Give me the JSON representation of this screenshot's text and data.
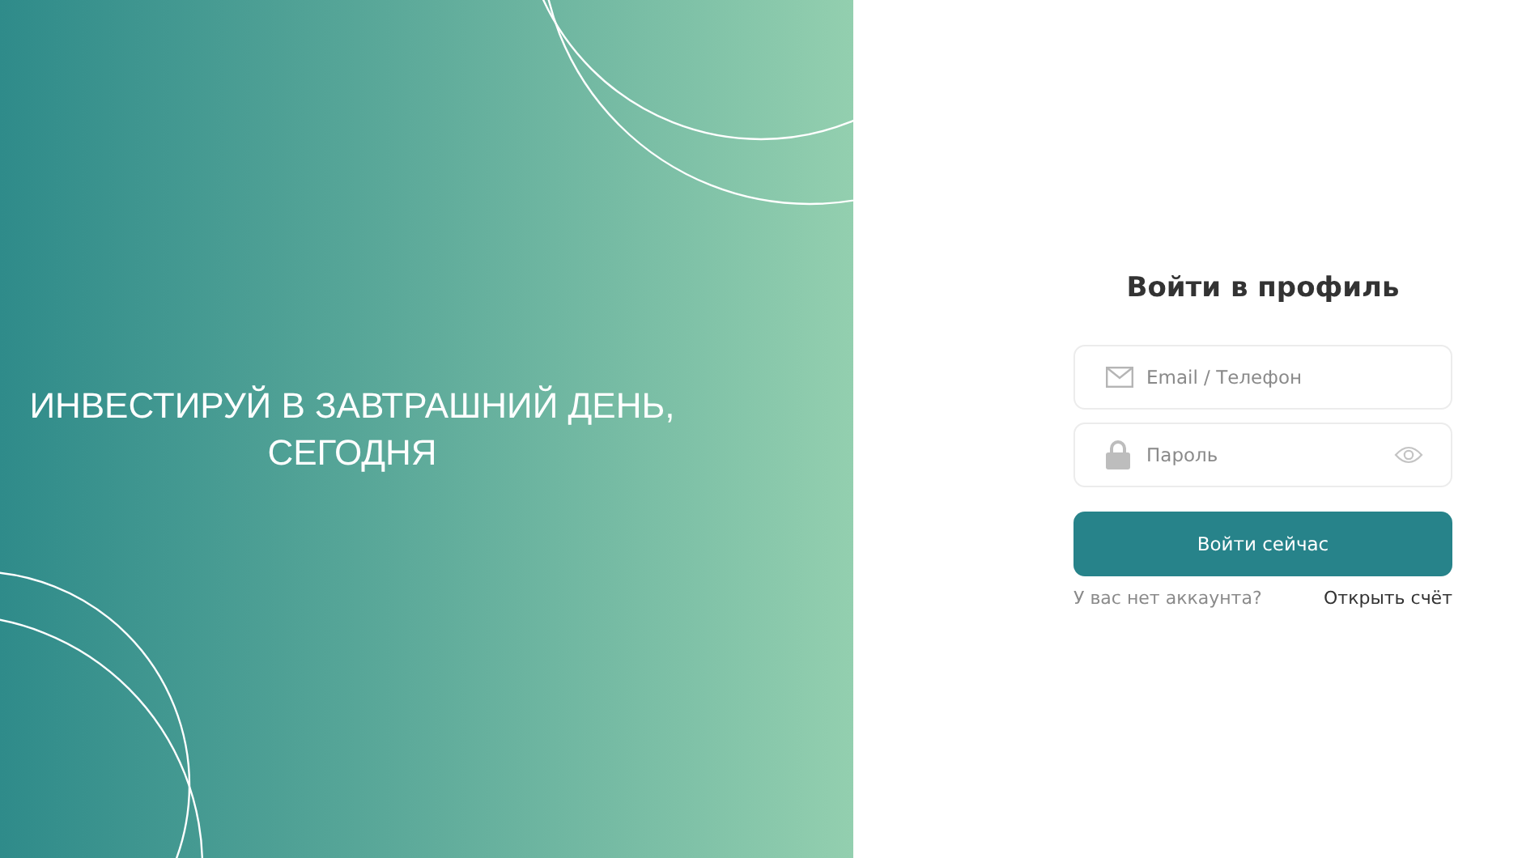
{
  "hero": {
    "headline_lines": [
      "ИНВЕСТИРУЙ В ЗАВТРАШНИЙ ДЕНЬ,",
      "СЕГОДНЯ"
    ]
  },
  "login": {
    "title": "Войти в профиль",
    "fields": [
      {
        "kind": "email",
        "placeholder": "Email / Телефон"
      },
      {
        "kind": "password",
        "placeholder": "Пароль"
      }
    ],
    "submit": "Войти сейчас",
    "signup_prompt": "У вас нет аккаунта?",
    "signup_link": "Открыть счёт"
  }
}
